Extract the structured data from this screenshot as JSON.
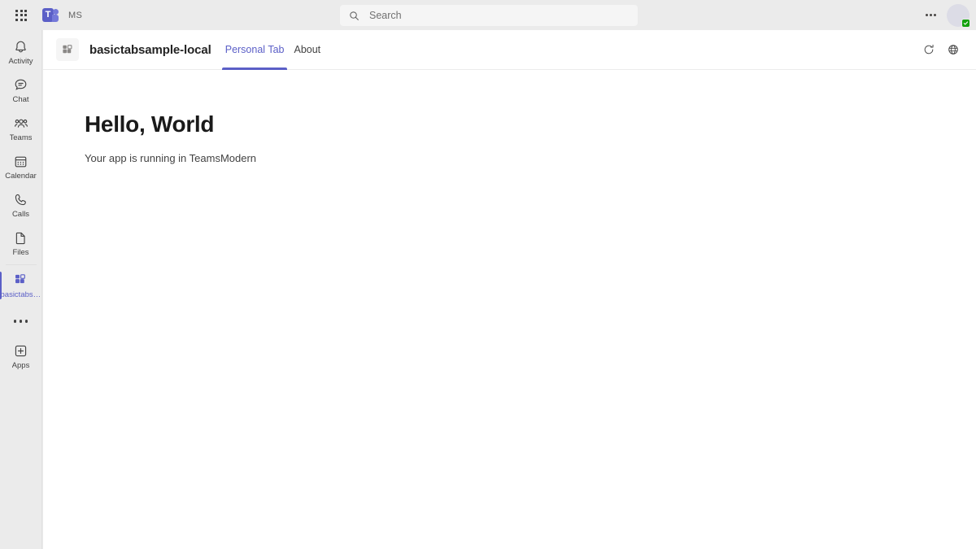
{
  "topbar": {
    "waffle_label": "app-launcher",
    "brand": "Microsoft Teams",
    "tenant_tag": "MS",
    "search": {
      "placeholder": "Search",
      "value": ""
    },
    "more_label": "…",
    "presence_status": "Available"
  },
  "rail": {
    "items": [
      {
        "label": "Activity",
        "icon": "bell-icon",
        "active": false
      },
      {
        "label": "Chat",
        "icon": "chat-icon",
        "active": false
      },
      {
        "label": "Teams",
        "icon": "teams-people-icon",
        "active": false
      },
      {
        "label": "Calendar",
        "icon": "calendar-icon",
        "active": false
      },
      {
        "label": "Calls",
        "icon": "phone-icon",
        "active": false
      },
      {
        "label": "Files",
        "icon": "file-icon",
        "active": false
      },
      {
        "label": "basictabsa…",
        "icon": "apps-grid-icon",
        "active": true
      }
    ],
    "overflow_label": "…",
    "apps": {
      "label": "Apps",
      "icon": "plus-square-icon"
    }
  },
  "appheader": {
    "app_icon": "apps-grid-icon",
    "title": "basictabsample-local",
    "tabs": [
      {
        "label": "Personal Tab",
        "active": true
      },
      {
        "label": "About",
        "active": false
      }
    ],
    "actions": [
      {
        "name": "refresh-icon",
        "title": "Refresh"
      },
      {
        "name": "globe-icon",
        "title": "Open in browser"
      }
    ]
  },
  "content": {
    "heading": "Hello, World",
    "subtext": "Your app is running in TeamsModern"
  },
  "colors": {
    "accent": "#5b5fc7",
    "chrome": "#ebebeb",
    "surface": "#ffffff",
    "text": "#242424",
    "presence_green": "#13a10e"
  }
}
